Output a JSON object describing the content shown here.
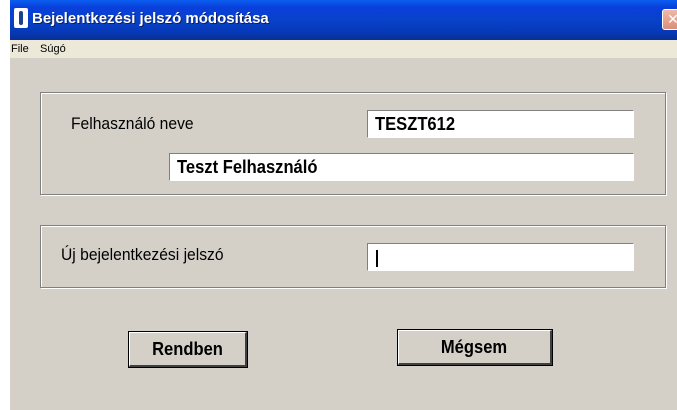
{
  "window": {
    "title": "Bejelentkezési jelszó módosítása",
    "close_symbol": "✕",
    "icon": "app-icon"
  },
  "menu": [
    {
      "label": "File"
    },
    {
      "label": "Súgó"
    }
  ],
  "user_group": {
    "username_label": "Felhasználó neve",
    "username_value": "TESZT612",
    "fullname_value": "Teszt Felhasználó"
  },
  "password_group": {
    "label": "Új bejelentkezési jelszó",
    "value": ""
  },
  "buttons": {
    "ok_label": "Rendben",
    "cancel_label": "Mégsem"
  },
  "colors": {
    "titlebar": "#0842c9",
    "face": "#d4d0c8"
  }
}
